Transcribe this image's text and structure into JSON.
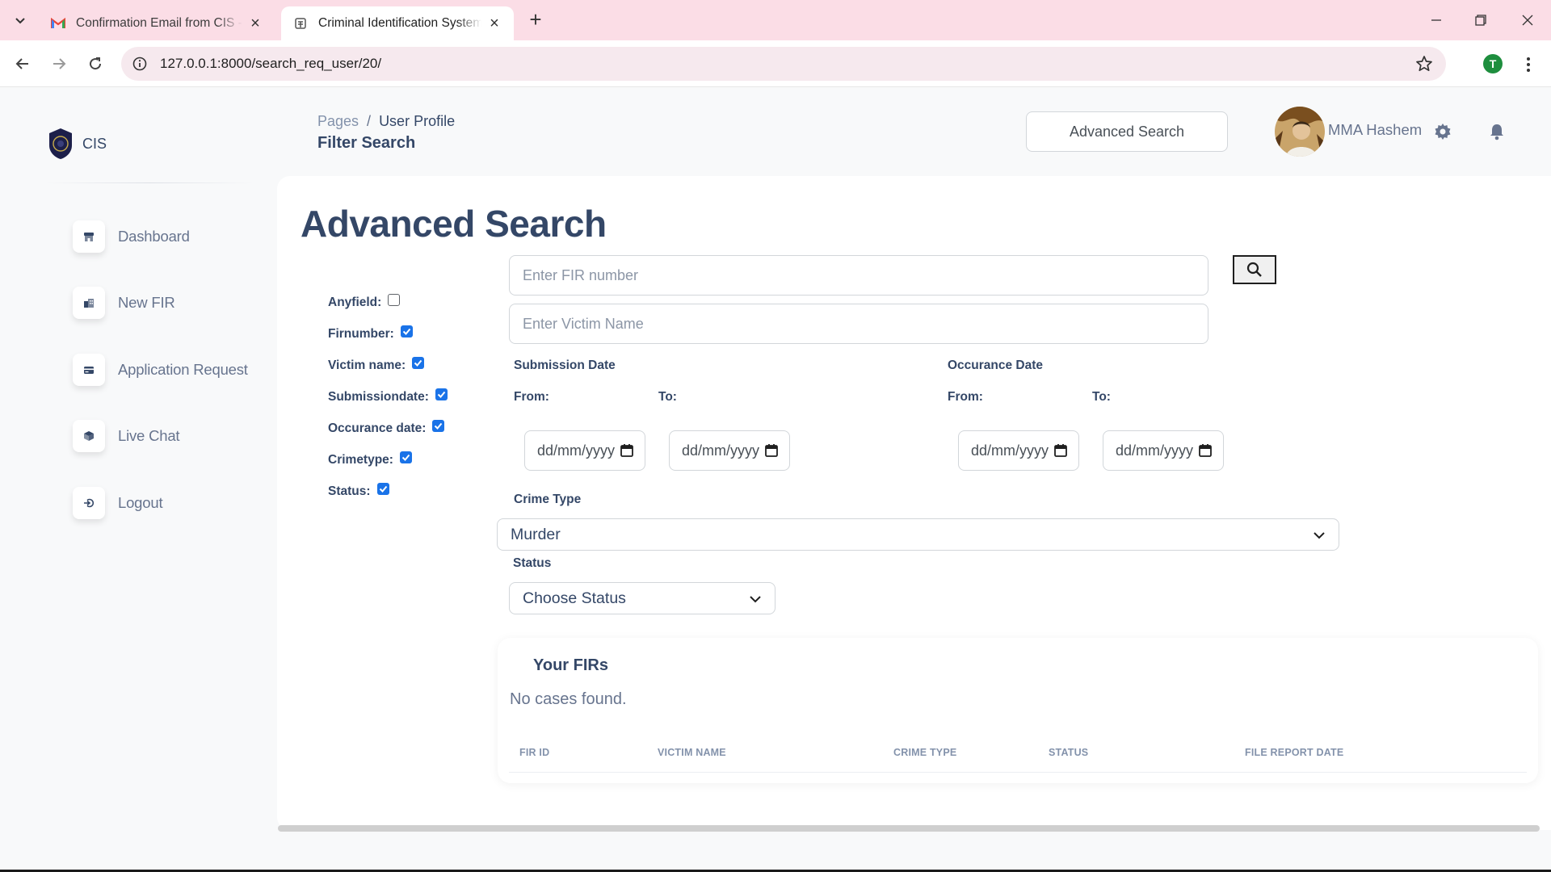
{
  "browser": {
    "tabs": [
      {
        "title": "Confirmation Email from CIS - t",
        "active": false,
        "icon": "gmail-icon"
      },
      {
        "title": "Criminal Identification System -",
        "active": true,
        "icon": "site-icon"
      }
    ],
    "url": "127.0.0.1:8000/search_req_user/20/",
    "profile_initial": "T"
  },
  "brand": {
    "name": "CIS"
  },
  "sidebar": {
    "items": [
      {
        "label": "Dashboard",
        "icon": "shop-icon"
      },
      {
        "label": "New FIR",
        "icon": "office-icon"
      },
      {
        "label": "Application Request",
        "icon": "credit-card-icon"
      },
      {
        "label": "Live Chat",
        "icon": "box-icon"
      },
      {
        "label": "Logout",
        "icon": "logout-icon"
      }
    ]
  },
  "header": {
    "breadcrumb": {
      "root": "Pages",
      "separator": "/",
      "current": "User Profile"
    },
    "page_title": "Filter Search",
    "search_button": "Advanced Search",
    "user_name": "MMA Hashem"
  },
  "main": {
    "title": "Advanced Search",
    "filters": [
      {
        "label": "Anyfield:",
        "checked": false
      },
      {
        "label": "Firnumber:",
        "checked": true
      },
      {
        "label": "Victim name:",
        "checked": true
      },
      {
        "label": "Submissiondate:",
        "checked": true
      },
      {
        "label": "Occurance date:",
        "checked": true
      },
      {
        "label": "Crimetype:",
        "checked": true
      },
      {
        "label": "Status:",
        "checked": true
      }
    ],
    "fir_placeholder": "Enter FIR number",
    "victim_placeholder": "Enter Victim Name",
    "submission_date": {
      "label": "Submission Date",
      "from": "From:",
      "to": "To:",
      "from_value": "dd/mm/yyyy",
      "to_value": "dd/mm/yyyy"
    },
    "occurance_date": {
      "label": "Occurance Date",
      "from": "From:",
      "to": "To:",
      "from_value": "dd/mm/yyyy",
      "to_value": "dd/mm/yyyy"
    },
    "crime_type": {
      "label": "Crime Type",
      "value": "Murder"
    },
    "status": {
      "label": "Status",
      "value": "Choose Status"
    }
  },
  "firs": {
    "title": "Your FIRs",
    "empty_message": "No cases found.",
    "columns": [
      "FIR ID",
      "VICTIM NAME",
      "CRIME TYPE",
      "STATUS",
      "FILE REPORT DATE"
    ]
  },
  "colors": {
    "accent": "#344767",
    "muted": "#67748e",
    "checkbox": "#1a73e8",
    "tabbar": "#fbdde6"
  }
}
